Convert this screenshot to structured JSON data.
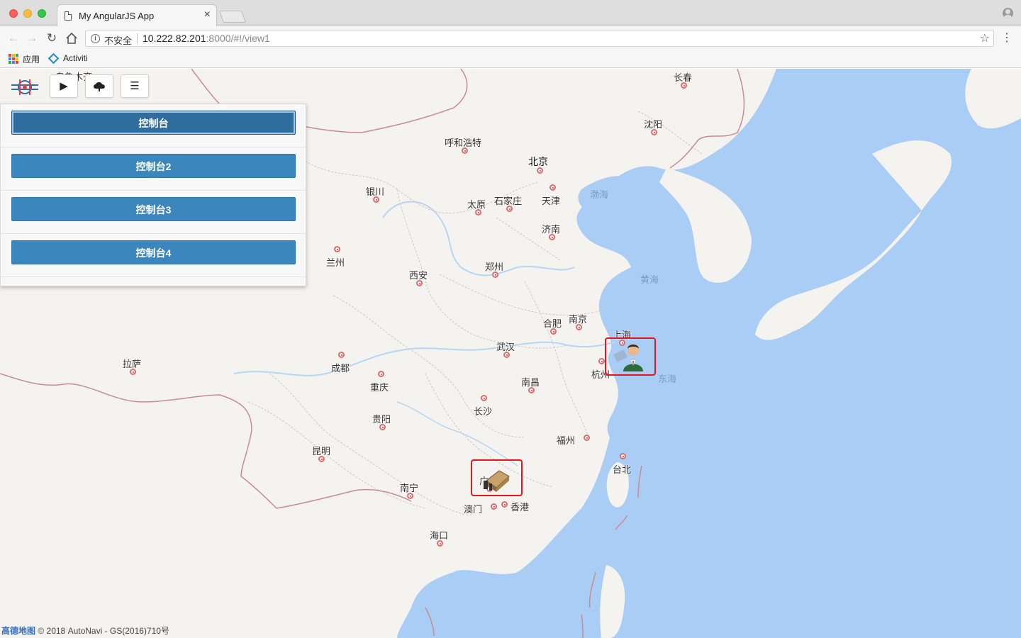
{
  "browser": {
    "tab_title": "My AngularJS App",
    "tab_close": "×",
    "security_label": "不安全",
    "url_host": "10.222.82.201",
    "url_rest": ":8000/#!/view1",
    "bookmarks": [
      {
        "label": "应用",
        "icon": "apps-grid-icon"
      },
      {
        "label": "Activiti",
        "icon": "activiti-diamond-icon"
      }
    ]
  },
  "toolbar": {
    "play_icon": "▶",
    "upload_icon": "cloud-upload-icon",
    "menu_icon": "☰"
  },
  "panel": {
    "buttons": [
      {
        "label": "控制台",
        "active": true
      },
      {
        "label": "控制台2",
        "active": false
      },
      {
        "label": "控制台3",
        "active": false
      },
      {
        "label": "控制台4",
        "active": false
      }
    ]
  },
  "map": {
    "cities": [
      {
        "name": "长春"
      },
      {
        "name": "沈阳"
      },
      {
        "name": "呼和浩特"
      },
      {
        "name": "北京"
      },
      {
        "name": "天津"
      },
      {
        "name": "石家庄"
      },
      {
        "name": "太原"
      },
      {
        "name": "银川"
      },
      {
        "name": "济南"
      },
      {
        "name": "兰州"
      },
      {
        "name": "郑州"
      },
      {
        "name": "西安"
      },
      {
        "name": "合肥"
      },
      {
        "name": "南京"
      },
      {
        "name": "上海"
      },
      {
        "name": "武汉"
      },
      {
        "name": "杭州"
      },
      {
        "name": "成都"
      },
      {
        "name": "拉萨"
      },
      {
        "name": "重庆"
      },
      {
        "name": "南昌"
      },
      {
        "name": "长沙"
      },
      {
        "name": "贵阳"
      },
      {
        "name": "福州"
      },
      {
        "name": "台北"
      },
      {
        "name": "昆明"
      },
      {
        "name": "广州"
      },
      {
        "name": "南宁"
      },
      {
        "name": "澳门"
      },
      {
        "name": "香港"
      },
      {
        "name": "海口"
      },
      {
        "name": "乌鲁木齐"
      }
    ],
    "seas": [
      {
        "name": "渤海"
      },
      {
        "name": "黄海"
      },
      {
        "name": "东海"
      }
    ],
    "copyright_brand": "高德地图",
    "copyright_text": "© 2018 AutoNavi - GS(2016)710号"
  },
  "colors": {
    "button_primary": "#3b86bd",
    "button_active": "#2f6d9e",
    "marker_border": "#e8141e",
    "sea": "#a9cdf4",
    "land": "#f5f3ef"
  }
}
